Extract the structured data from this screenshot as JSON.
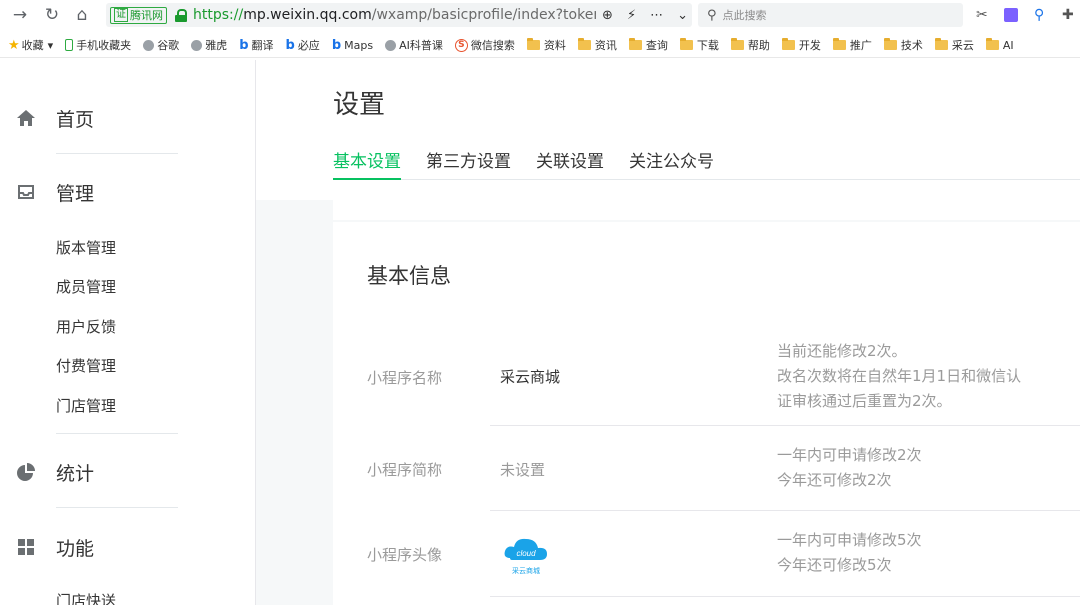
{
  "browser": {
    "cert_label": "腾讯网",
    "cert_badge": "证",
    "url_proto": "https://",
    "url_host": "mp.weixin.qq.com",
    "url_path": "/wxamp/basicprofile/index?token=",
    "search_placeholder": "点此搜索",
    "bookmarks": [
      {
        "label": "收藏",
        "icon": "star-icon"
      },
      {
        "label": "手机收藏夹",
        "icon": "phone-icon"
      },
      {
        "label": "谷歌",
        "icon": "globe-icon"
      },
      {
        "label": "雅虎",
        "icon": "globe-icon"
      },
      {
        "label": "翻译",
        "icon": "bing-icon"
      },
      {
        "label": "必应",
        "icon": "bing-icon"
      },
      {
        "label": "Maps",
        "icon": "bing-icon"
      },
      {
        "label": "AI科普课",
        "icon": "globe-icon"
      },
      {
        "label": "微信搜索",
        "icon": "sogou-icon"
      },
      {
        "label": "资料",
        "icon": "folder-icon"
      },
      {
        "label": "资讯",
        "icon": "folder-icon"
      },
      {
        "label": "查询",
        "icon": "folder-icon"
      },
      {
        "label": "下载",
        "icon": "folder-icon"
      },
      {
        "label": "帮助",
        "icon": "folder-icon"
      },
      {
        "label": "开发",
        "icon": "folder-icon"
      },
      {
        "label": "推广",
        "icon": "folder-icon"
      },
      {
        "label": "技术",
        "icon": "folder-icon"
      },
      {
        "label": "采云",
        "icon": "folder-icon"
      },
      {
        "label": "AI",
        "icon": "folder-icon"
      }
    ]
  },
  "sidebar": {
    "home": "首页",
    "manage": "管理",
    "manage_items": [
      "版本管理",
      "成员管理",
      "用户反馈",
      "付费管理",
      "门店管理"
    ],
    "stats": "统计",
    "features": "功能",
    "features_items": [
      "门店快送"
    ]
  },
  "main": {
    "title": "设置",
    "tabs": [
      "基本设置",
      "第三方设置",
      "关联设置",
      "关注公众号"
    ],
    "active_tab": "基本设置",
    "section_title": "基本信息",
    "rows": [
      {
        "label": "小程序名称",
        "value": "采云商城",
        "desc": [
          "当前还能修改2次。",
          "改名次数将在自然年1月1日和微信认",
          "证审核通过后重置为2次。"
        ]
      },
      {
        "label": "小程序简称",
        "value": "未设置",
        "desc": [
          "一年内可申请修改2次",
          "今年还可修改2次"
        ]
      },
      {
        "label": "小程序头像",
        "value": "",
        "desc": [
          "一年内可申请修改5次",
          "今年还可修改5次"
        ]
      }
    ],
    "avatar": {
      "cloud_text": "cloud",
      "brand_text": "采云商城"
    }
  },
  "colors": {
    "accent": "#07c160",
    "muted": "#9a9a9a",
    "text": "#353535"
  }
}
